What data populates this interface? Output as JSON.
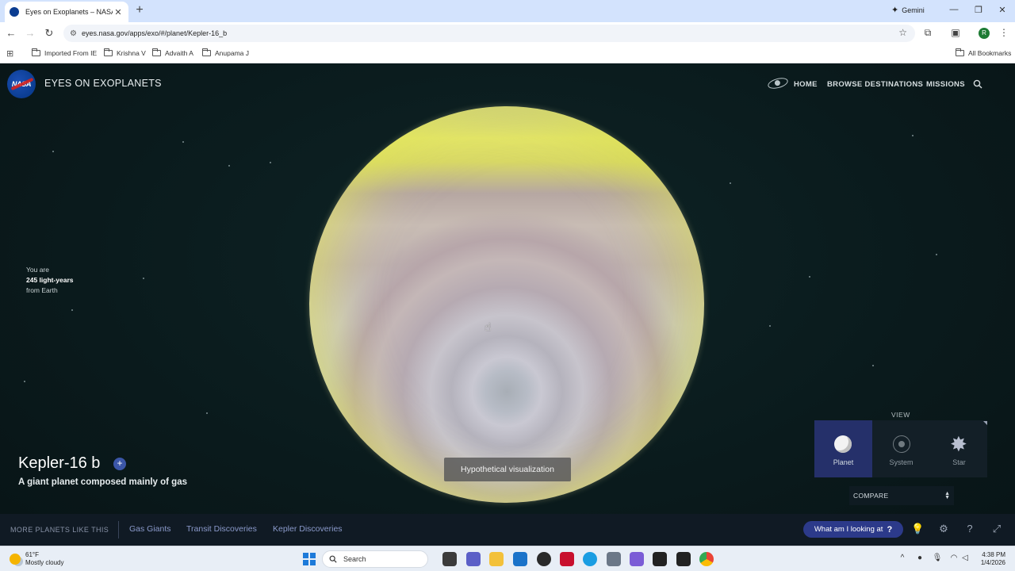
{
  "browser": {
    "tab_title": "Eyes on Exoplanets – NASA/JPL",
    "tab_close": "✕",
    "new_tab": "+",
    "gemini_label": "Gemini",
    "url": "eyes.nasa.gov/apps/exo/#/planet/Kepler-16_b",
    "profile_initial": "R",
    "bookmarks": [
      "Imported From IE",
      "Krishna V",
      "Advaith A",
      "Anupama J"
    ],
    "all_bookmarks": "All Bookmarks"
  },
  "app": {
    "logo_text": "NASA",
    "title": "EYES ON EXOPLANETS",
    "nav": {
      "home": "HOME",
      "browse": "BROWSE DESTINATIONS",
      "missions": "MISSIONS"
    },
    "distance": {
      "line1": "You are",
      "value": "245 light-years",
      "line3": "from Earth"
    },
    "planet": {
      "name": "Kepler-16 b",
      "description": "A giant planet composed mainly of gas",
      "plus": "+"
    },
    "hypothetical_label": "Hypothetical visualization",
    "view": {
      "label": "VIEW",
      "options": [
        "Planet",
        "System",
        "Star"
      ],
      "active": "Planet"
    },
    "compare_label": "COMPARE",
    "bottom": {
      "more_label": "MORE PLANETS LIKE THIS",
      "links": [
        "Gas Giants",
        "Transit Discoveries",
        "Kepler Discoveries"
      ],
      "what_am_i": "What am I looking at",
      "q": "?"
    }
  },
  "taskbar": {
    "temp": "61°F",
    "weather": "Mostly cloudy",
    "search_placeholder": "Search",
    "time": "4:38 PM",
    "date": "1/4/2026"
  },
  "colors": {
    "accent": "#25306a",
    "link": "#8b9acb",
    "background": "#0b1a1c"
  }
}
